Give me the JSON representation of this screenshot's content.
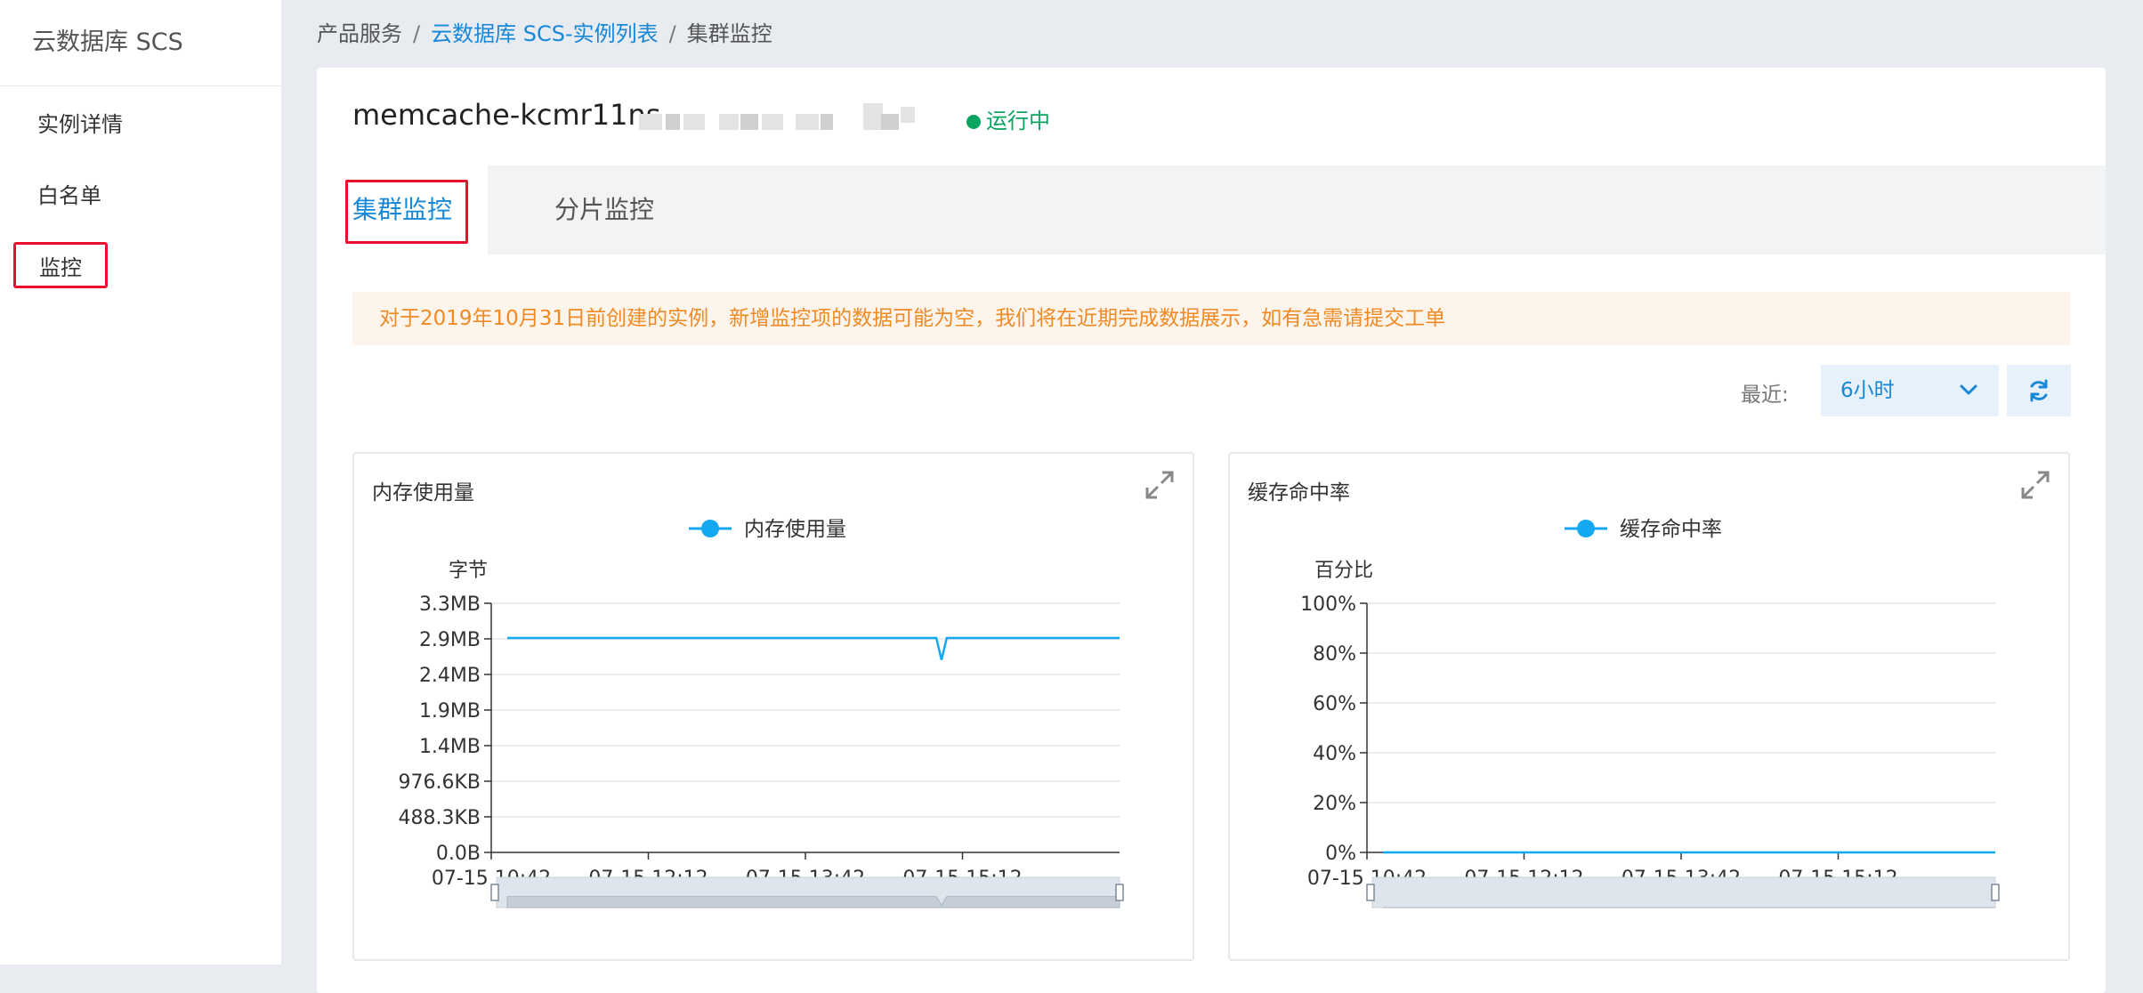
{
  "sidebar": {
    "brand": "云数据库 SCS",
    "items": [
      {
        "label": "实例详情",
        "active": false
      },
      {
        "label": "白名单",
        "active": false
      },
      {
        "label": "监控",
        "active": true
      }
    ]
  },
  "breadcrumb": {
    "root": "产品服务",
    "link": "云数据库 SCS-实例列表",
    "current": "集群监控",
    "sep": "/"
  },
  "instance": {
    "name": "memcache-kcmr11ns",
    "status": "运行中",
    "status_color": "#0ba360"
  },
  "tabs": [
    {
      "label": "集群监控",
      "active": true
    },
    {
      "label": "分片监控",
      "active": false
    }
  ],
  "notice": "对于2019年10月31日前创建的实例，新增监控项的数据可能为空，我们将在近期完成数据展示，如有急需请提交工单",
  "range": {
    "label": "最近:",
    "value": "6小时"
  },
  "colors": {
    "accent": "#1787d8",
    "series": "#13a8f0",
    "highlight_border": "#e8102e",
    "notice_text": "#f08a24"
  },
  "chart_data": [
    {
      "type": "line",
      "title": "内存使用量",
      "legend": [
        "内存使用量"
      ],
      "ylabel": "字节",
      "yticks": [
        "0.0B",
        "488.3KB",
        "976.6KB",
        "1.4MB",
        "1.9MB",
        "2.4MB",
        "2.9MB",
        "3.3MB"
      ],
      "ylim": [
        0,
        3.3
      ],
      "xticks": [
        "07-15 10:42",
        "07-15 12:12",
        "07-15 13:42",
        "07-15 15:12"
      ],
      "series": [
        {
          "name": "内存使用量",
          "x": [
            "10:42",
            "14:57",
            "15:00",
            "15:03",
            "16:42"
          ],
          "values": [
            2.84,
            2.84,
            2.55,
            2.84,
            2.84
          ]
        }
      ]
    },
    {
      "type": "line",
      "title": "缓存命中率",
      "legend": [
        "缓存命中率"
      ],
      "ylabel": "百分比",
      "yticks": [
        "0%",
        "20%",
        "40%",
        "60%",
        "80%",
        "100%"
      ],
      "ylim": [
        0,
        100
      ],
      "xticks": [
        "07-15 10:42",
        "07-15 12:12",
        "07-15 13:42",
        "07-15 15:12"
      ],
      "series": [
        {
          "name": "缓存命中率",
          "x": [
            "10:42",
            "16:42"
          ],
          "values": [
            0,
            0
          ]
        }
      ]
    }
  ]
}
